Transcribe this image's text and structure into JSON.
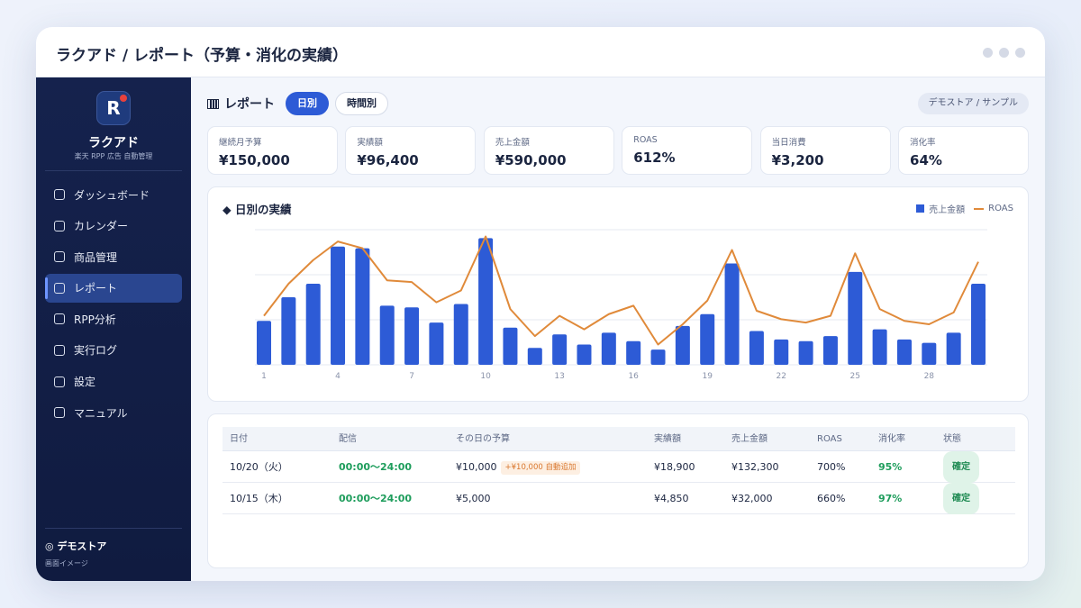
{
  "window": {
    "title": "ラクアド / レポート（予算・消化の実績）"
  },
  "sidebar": {
    "logo_letter": "R",
    "brand": "ラクアド",
    "brand_sub": "楽天 RPP 広告 自動管理",
    "items": [
      {
        "label": "ダッシュボード",
        "active": false
      },
      {
        "label": "カレンダー",
        "active": false
      },
      {
        "label": "商品管理",
        "active": false
      },
      {
        "label": "レポート",
        "active": true
      },
      {
        "label": "RPP分析",
        "active": false
      },
      {
        "label": "実行ログ",
        "active": false
      },
      {
        "label": "設定",
        "active": false
      },
      {
        "label": "マニュアル",
        "active": false
      }
    ],
    "store": "◎ デモストア",
    "store_sub": "画面イメージ"
  },
  "header": {
    "title": "レポート",
    "tabs": [
      {
        "label": "日別",
        "selected": true
      },
      {
        "label": "時間別",
        "selected": false
      }
    ],
    "store_pill": "デモストア / サンプル"
  },
  "kpis": [
    {
      "label": "継続月予算",
      "value": "¥150,000"
    },
    {
      "label": "実績額",
      "value": "¥96,400"
    },
    {
      "label": "売上金額",
      "value": "¥590,000"
    },
    {
      "label": "ROAS",
      "value": "612%"
    },
    {
      "label": "当日消費",
      "value": "¥3,200"
    },
    {
      "label": "消化率",
      "value": "64%"
    }
  ],
  "chart_data": {
    "type": "bar",
    "title": "◆ 日別の実績",
    "x": [
      1,
      2,
      3,
      4,
      5,
      6,
      7,
      8,
      9,
      10,
      11,
      12,
      13,
      14,
      15,
      16,
      17,
      18,
      19,
      20,
      21,
      22,
      23,
      24,
      25,
      26,
      27,
      28,
      29,
      30
    ],
    "x_tick_labels": [
      "1",
      "4",
      "7",
      "10",
      "13",
      "16",
      "19",
      "22",
      "25",
      "28"
    ],
    "grid": true,
    "series": [
      {
        "name": "売上金額",
        "kind": "bar",
        "color": "#2d5bd6",
        "values": [
          26,
          40,
          48,
          70,
          69,
          35,
          34,
          25,
          36,
          75,
          22,
          10,
          18,
          12,
          19,
          14,
          9,
          23,
          30,
          60,
          20,
          15,
          14,
          17,
          55,
          21,
          15,
          13,
          19,
          48
        ]
      },
      {
        "name": "ROAS",
        "kind": "line",
        "color": "#e08a3a",
        "values": [
          29,
          48,
          62,
          73,
          69,
          50,
          49,
          37,
          44,
          76,
          33,
          17,
          29,
          21,
          30,
          35,
          12,
          24,
          38,
          68,
          32,
          27,
          25,
          29,
          66,
          33,
          26,
          24,
          31,
          61
        ]
      }
    ],
    "ylim": [
      0,
      80
    ]
  },
  "table": {
    "headers": [
      "日付",
      "配信",
      "その日の予算",
      "実績額",
      "売上金額",
      "ROAS",
      "消化率",
      "状態"
    ],
    "rows": [
      {
        "date": "10/20（火）",
        "delivery": "00:00〜24:00",
        "budget": "¥10,000",
        "budget_badge": "+¥10,000 自動追加",
        "actual": "¥18,900",
        "sales": "¥132,300",
        "roas": "700%",
        "rate": "95%",
        "status": "確定"
      },
      {
        "date": "10/15（木）",
        "delivery": "00:00〜24:00",
        "budget": "¥5,000",
        "budget_badge": "",
        "actual": "¥4,850",
        "sales": "¥32,000",
        "roas": "660%",
        "rate": "97%",
        "status": "確定"
      }
    ]
  }
}
